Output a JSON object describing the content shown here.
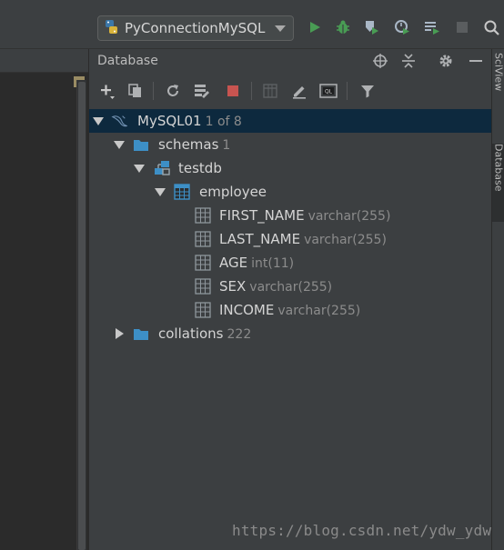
{
  "toolbar": {
    "run_config": "PyConnectionMySQL",
    "icons": [
      "python-icon",
      "run-icon",
      "debug-icon",
      "coverage-icon",
      "profile-icon",
      "concurrency-icon",
      "stop-icon",
      "search-icon"
    ]
  },
  "panel": {
    "title": "Database",
    "header_icons": [
      "crosshair-icon",
      "collapse-icon",
      "gear-icon",
      "minimize-icon"
    ],
    "toolbar_icons": [
      "add-icon",
      "duplicate-icon",
      "refresh-icon",
      "schema-icon",
      "stop-icon",
      "table-icon",
      "edit-icon",
      "console-icon",
      "filter-icon"
    ]
  },
  "tree": {
    "datasource": {
      "name": "MySQL01",
      "meta": "1 of 8"
    },
    "schemas": {
      "name": "schemas",
      "count": "1"
    },
    "db": {
      "name": "testdb"
    },
    "table": {
      "name": "employee"
    },
    "columns": [
      {
        "name": "FIRST_NAME",
        "type": "varchar(255)"
      },
      {
        "name": "LAST_NAME",
        "type": "varchar(255)"
      },
      {
        "name": "AGE",
        "type": "int(11)"
      },
      {
        "name": "SEX",
        "type": "varchar(255)"
      },
      {
        "name": "INCOME",
        "type": "varchar(255)"
      }
    ],
    "collations": {
      "name": "collations",
      "count": "222"
    }
  },
  "right_tabs": {
    "sciview": "SciView",
    "database": "Database"
  },
  "watermark": "https://blog.csdn.net/ydw_ydw",
  "colors": {
    "selection": "#0d293e",
    "folder": "#3d8fc6",
    "run": "#499c54",
    "stop": "#c75450"
  }
}
